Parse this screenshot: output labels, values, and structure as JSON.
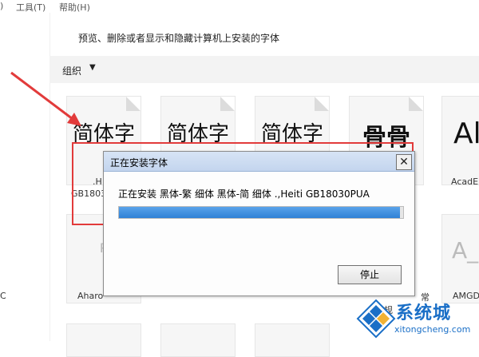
{
  "menu": {
    "tools": "工具(T)",
    "help": "帮助(H)"
  },
  "description": "预览、删除或者显示和隐藏计算机上安装的字体",
  "toolbar": {
    "organize": "组织",
    "caret": "▼"
  },
  "tiles": [
    {
      "glyph": "简体字"
    },
    {
      "glyph": "简体字"
    },
    {
      "glyph": "简体字"
    },
    {
      "glyph": "骨骨"
    },
    {
      "glyph": "Al"
    }
  ],
  "tile_labels": {
    "gb_line1": ".H",
    "gb_line2": "GB1803",
    "acad": "AcadE",
    "aharo": "Aharo",
    "amgd": "AMGD",
    "cjk_fragment": "常",
    "cjk_fragment2": "规",
    "left_c": "C"
  },
  "dialog": {
    "title": "正在安装字体",
    "close": "✕",
    "message": "正在安装 黑体-繁 细体 黑体-简 细体 .,Heiti GB18030PUA",
    "progress_fraction": 0.99,
    "stop_label": "停止"
  },
  "watermark": {
    "brand": "系统城",
    "url": "xitongcheng.com"
  },
  "colors": {
    "annotation_red": "#e23b3b",
    "progress_blue": "#2f81d6",
    "watermark_blue": "#1a6fc7"
  }
}
